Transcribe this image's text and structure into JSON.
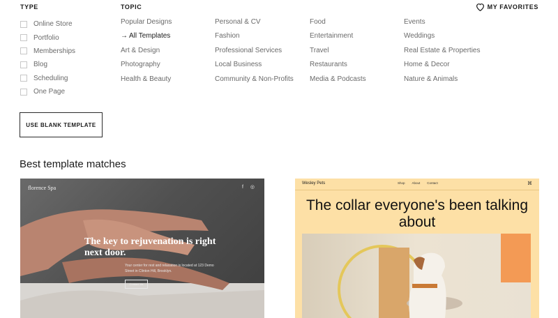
{
  "filters": {
    "type_header": "TYPE",
    "type_items": [
      "Online Store",
      "Portfolio",
      "Memberships",
      "Blog",
      "Scheduling",
      "One Page"
    ],
    "topic_header": "TOPIC",
    "topic_columns": [
      [
        "Popular Designs",
        "All Templates",
        "Art & Design",
        "Photography",
        "Health & Beauty"
      ],
      [
        "Personal & CV",
        "Fashion",
        "Professional Services",
        "Local Business",
        "Community & Non-Profits"
      ],
      [
        "Food",
        "Entertainment",
        "Travel",
        "Restaurants",
        "Media & Podcasts"
      ],
      [
        "Events",
        "Weddings",
        "Real Estate & Properties",
        "Home & Decor",
        "Nature & Animals"
      ]
    ],
    "active_topic": "All Templates",
    "active_icon": "arrow-right-icon"
  },
  "favorites": {
    "label": "MY FAVORITES",
    "icon": "heart-icon"
  },
  "blank_template_button": "USE BLANK TEMPLATE",
  "section_title": "Best template matches",
  "templates": [
    {
      "site_name": "florence Spa",
      "social": "f ◎",
      "headline": "The key to rejuvenation is right next door.",
      "subtext": "Your center for rest and relaxation is located at 123 Demo Street in Clinton Hill, Brooklyn.",
      "button": "Contact Us"
    },
    {
      "site_name": "Wesley Pets",
      "nav": [
        "Shop",
        "About",
        "Contact"
      ],
      "headline": "The collar everyone's been talking about",
      "cart_icon": "cart-icon"
    }
  ],
  "colors": {
    "accent_card2": "#fde0a6",
    "text_dark": "#1b1b1b",
    "text_muted": "#6a6a6a"
  }
}
